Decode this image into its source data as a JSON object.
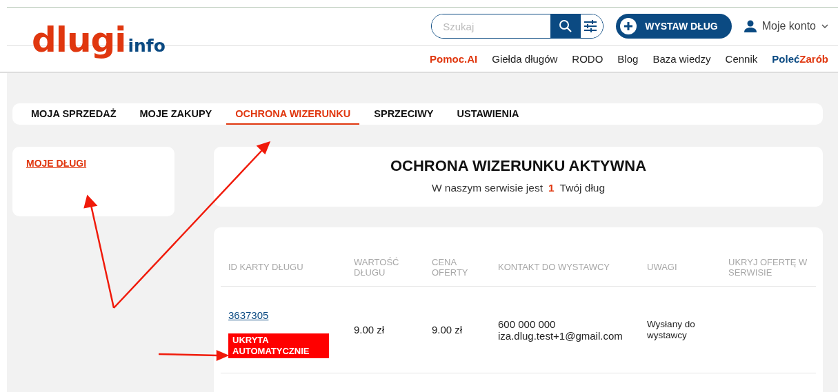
{
  "header": {
    "logo": {
      "main": "dlugi",
      "suffix": "info"
    },
    "search": {
      "placeholder": "Szukaj"
    },
    "cta": "WYSTAW DŁUG",
    "account": "Moje konto",
    "nav": [
      {
        "label": "Pomoc.AI",
        "kind": "accent"
      },
      {
        "label": "Giełda długów",
        "kind": "plain"
      },
      {
        "label": "RODO",
        "kind": "plain"
      },
      {
        "label": "Blog",
        "kind": "plain"
      },
      {
        "label": "Baza wiedzy",
        "kind": "plain"
      },
      {
        "label": "Cennik",
        "kind": "plain"
      },
      {
        "label": "Poleć",
        "label_second": "Zarób",
        "kind": "split"
      }
    ]
  },
  "tabs": [
    {
      "label": "MOJA SPRZEDAŻ",
      "selected": false
    },
    {
      "label": "MOJE ZAKUPY",
      "selected": false
    },
    {
      "label": "OCHRONA WIZERUNKU",
      "selected": true
    },
    {
      "label": "SPRZECIWY",
      "selected": false
    },
    {
      "label": "USTAWIENIA",
      "selected": false
    }
  ],
  "sidebar": {
    "items": [
      {
        "label": "MOJE DŁUGI",
        "selected": true
      }
    ]
  },
  "status": {
    "title": "OCHRONA WIZERUNKU AKTYWNA",
    "text": "W naszym serwisie jest",
    "count": "1",
    "suffix": "Twój dług"
  },
  "table": {
    "columns": [
      "ID KARTY DŁUGU",
      "WARTOŚĆ DŁUGU",
      "CENA OFERTY",
      "KONTAKT DO WYSTAWCY",
      "UWAGI",
      "UKRYJ OFERTĘ W SERWISIE"
    ],
    "rows": [
      {
        "id": "3637305",
        "badge": "UKRYTA AUTOMATYCZNIE",
        "value": "9.00 zł",
        "price": "9.00 zł",
        "phone": "600 000 000",
        "email": "iza.dlug.test+1@gmail.com",
        "note": "Wysłany do wystawcy"
      }
    ]
  }
}
